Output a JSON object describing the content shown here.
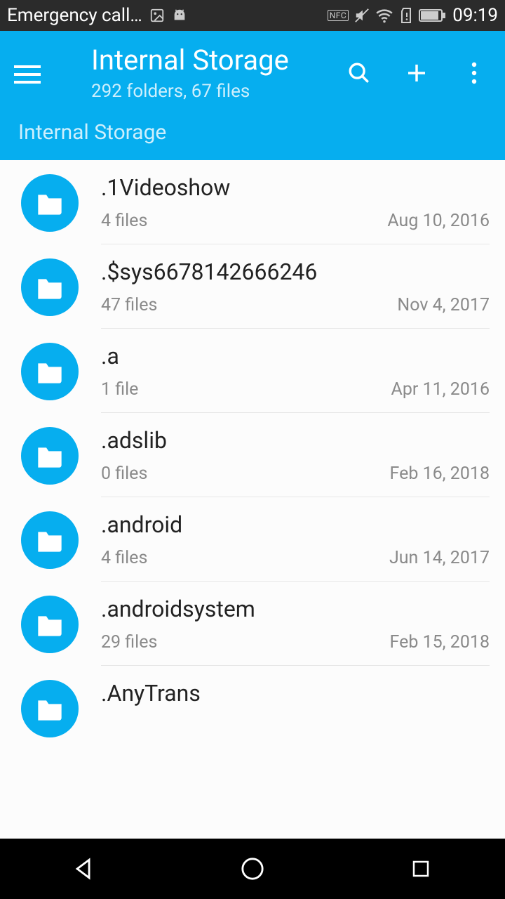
{
  "status": {
    "left_text": "Emergency call…",
    "nfc": "NFC",
    "time": "09:19"
  },
  "appbar": {
    "title": "Internal Storage",
    "subtitle": "292 folders, 67 files"
  },
  "breadcrumb": "Internal Storage",
  "folders": [
    {
      "name": ".1Videoshow",
      "files": "4 files",
      "date": "Aug 10, 2016"
    },
    {
      "name": ".$sys6678142666246",
      "files": "47 files",
      "date": "Nov 4, 2017"
    },
    {
      "name": ".a",
      "files": "1 file",
      "date": "Apr 11, 2016"
    },
    {
      "name": ".adslib",
      "files": "0 files",
      "date": "Feb 16, 2018"
    },
    {
      "name": ".android",
      "files": "4 files",
      "date": "Jun 14, 2017"
    },
    {
      "name": ".androidsystem",
      "files": "29 files",
      "date": "Feb 15, 2018"
    },
    {
      "name": ".AnyTrans",
      "files": "",
      "date": ""
    }
  ]
}
